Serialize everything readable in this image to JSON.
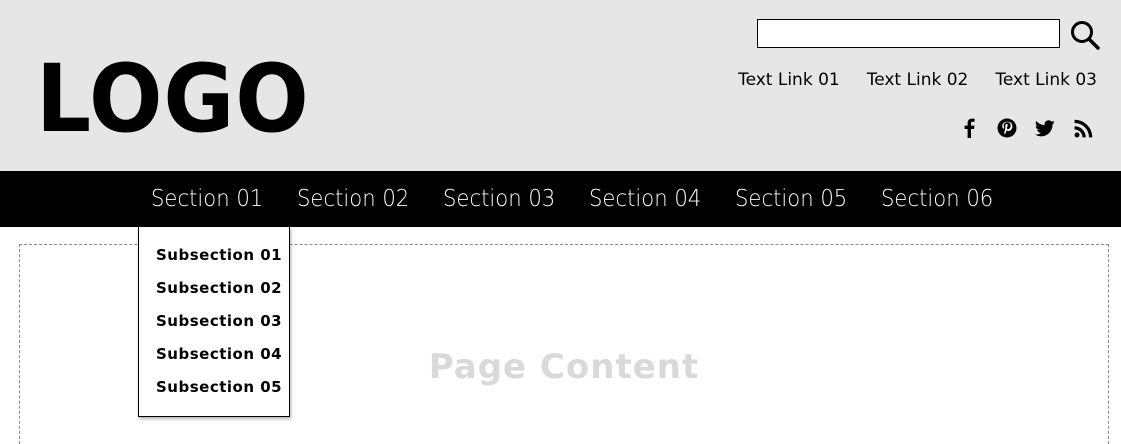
{
  "header": {
    "logo": "LOGO",
    "search": {
      "value": "",
      "placeholder": ""
    },
    "top_links": [
      "Text Link 01",
      "Text Link 02",
      "Text Link 03"
    ],
    "social_icons": [
      "facebook-icon",
      "pinterest-icon",
      "twitter-icon",
      "rss-icon"
    ]
  },
  "nav": {
    "sections": [
      "Section 01",
      "Section 02",
      "Section 03",
      "Section 04",
      "Section 05",
      "Section 06"
    ],
    "open_section": "Section 01",
    "dropdown": [
      "Subsection 01",
      "Subsection 02",
      "Subsection 03",
      "Subsection 04",
      "Subsection 05"
    ]
  },
  "content": {
    "label": "Page Content"
  },
  "colors": {
    "header_bg": "#e6e6e6",
    "nav_bg": "#000000",
    "nav_text": "#ffffff",
    "content_label": "#d9d9d9"
  }
}
